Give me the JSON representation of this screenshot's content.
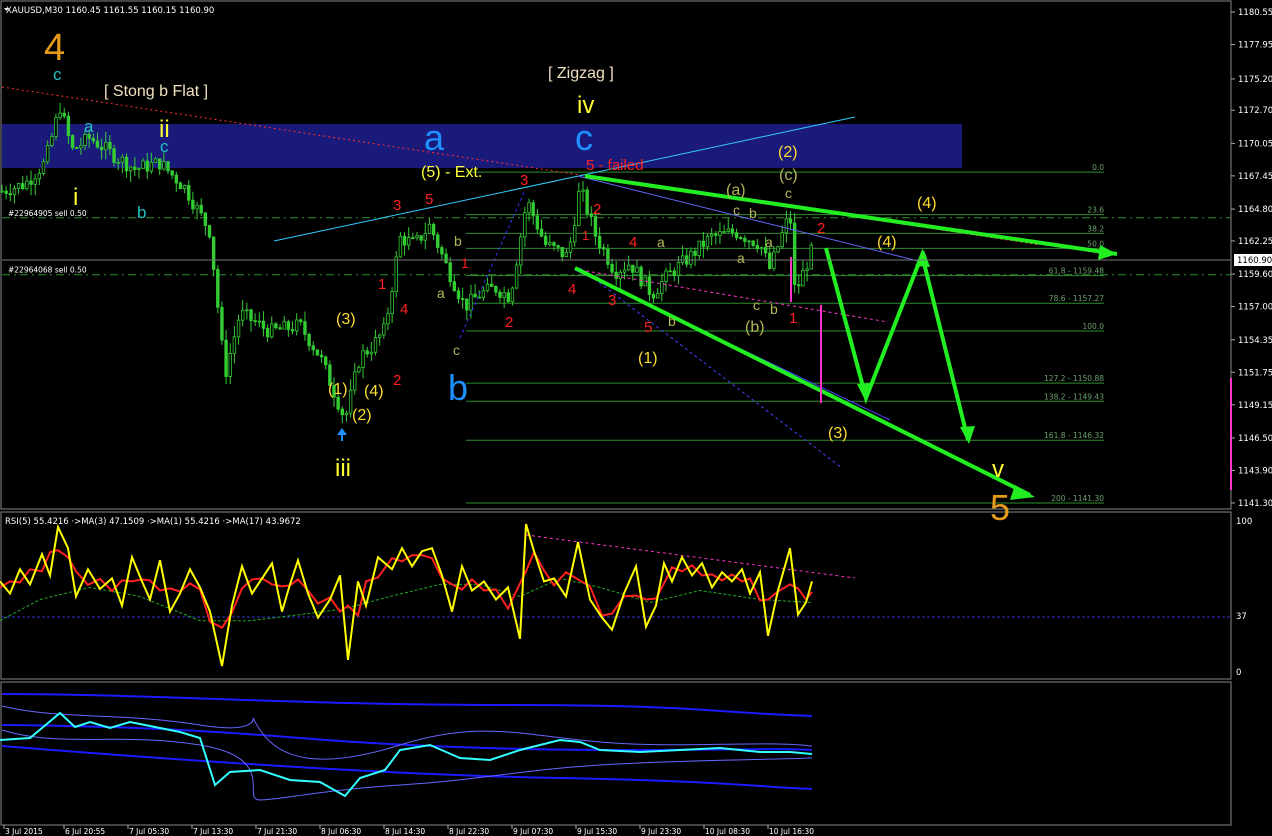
{
  "window": {
    "header": "XAUUSD,M30  1160.45 1161.55 1160.15 1160.90"
  },
  "colors": {
    "background": "#000000",
    "candles": "#33cc33",
    "price_axis_text": "#ffffff",
    "supply_zone": "#1a1a7a",
    "fib_lines": "#2e8b2e",
    "wave_red": "#ff2020",
    "wave_yellow": "#ffff33",
    "wave_blue": "#1e90ff",
    "wave_cyan": "#00ccff",
    "wave_orange": "#e69a1a",
    "wave_olive": "#b5b55a",
    "projection_arrows": "#22ee22",
    "rsi_line": "#ffff00",
    "rsi_ma3": "#ff2020",
    "rsi_ma17": "#22aa22",
    "bands": "#1a1aff",
    "osc_line": "#33ffff",
    "magenta": "#ff33cc"
  },
  "chart_data": [
    {
      "type": "candlestick",
      "title": "XAUUSD,M30",
      "ohlc": {
        "open": 1160.45,
        "high": 1161.55,
        "low": 1160.15,
        "close": 1160.9
      },
      "last_price": "1160.90",
      "ylim": [
        1140.5,
        1181.5
      ],
      "y_ticks": [
        "1180.55",
        "1177.95",
        "1175.20",
        "1172.70",
        "1170.05",
        "1167.45",
        "1164.80",
        "1162.25",
        "1159.60",
        "1157.00",
        "1154.35",
        "1151.75",
        "1149.15",
        "1146.50",
        "1143.90",
        "1141.30"
      ],
      "x_ticks": [
        "3 Jul 2015",
        "6 Jul 20:55",
        "7 Jul 05:30",
        "7 Jul 13:30",
        "7 Jul 21:30",
        "8 Jul 06:30",
        "8 Jul 14:30",
        "8 Jul 22:30",
        "9 Jul 07:30",
        "9 Jul 15:30",
        "9 Jul 23:30",
        "10 Jul 08:30",
        "10 Jul 16:30"
      ],
      "price_anchors": [
        [
          0,
          1166.2
        ],
        [
          25,
          1166.8
        ],
        [
          45,
          1168.5
        ],
        [
          60,
          1173.0
        ],
        [
          72,
          1169.5
        ],
        [
          90,
          1170.5
        ],
        [
          112,
          1169.2
        ],
        [
          135,
          1168.0
        ],
        [
          160,
          1168.5
        ],
        [
          185,
          1166.5
        ],
        [
          210,
          1163.0
        ],
        [
          225,
          1151.5
        ],
        [
          240,
          1156.5
        ],
        [
          270,
          1155.0
        ],
        [
          300,
          1155.5
        ],
        [
          320,
          1153.0
        ],
        [
          345,
          1148.0
        ],
        [
          360,
          1153.0
        ],
        [
          372,
          1153.8
        ],
        [
          385,
          1155.2
        ],
        [
          400,
          1162.5
        ],
        [
          415,
          1162.0
        ],
        [
          430,
          1163.5
        ],
        [
          445,
          1160.5
        ],
        [
          465,
          1157.0
        ],
        [
          480,
          1158.0
        ],
        [
          495,
          1158.5
        ],
        [
          510,
          1157.8
        ],
        [
          527,
          1165.5
        ],
        [
          545,
          1162.0
        ],
        [
          568,
          1161.0
        ],
        [
          580,
          1166.5
        ],
        [
          595,
          1162.8
        ],
        [
          615,
          1159.8
        ],
        [
          630,
          1160.5
        ],
        [
          652,
          1158.0
        ],
        [
          668,
          1159.5
        ],
        [
          690,
          1161.0
        ],
        [
          710,
          1162.5
        ],
        [
          735,
          1163.0
        ],
        [
          760,
          1162.0
        ],
        [
          770,
          1160.0
        ],
        [
          790,
          1164.5
        ],
        [
          795,
          1158.0
        ],
        [
          812,
          1161.5
        ]
      ],
      "candle_step": 4.15,
      "fibonacci": [
        {
          "level": "0.0",
          "price": 1167.75
        },
        {
          "level": "23.6",
          "price": 1164.35
        },
        {
          "level": "38.2",
          "price": 1162.85
        },
        {
          "level": "50.0",
          "price": 1161.65
        },
        {
          "level": "61.8 - 1159.48",
          "price": 1159.48
        },
        {
          "level": "78.6 - 1157.27",
          "price": 1157.27
        },
        {
          "level": "100.0",
          "price": 1155.05
        },
        {
          "level": "127.2 - 1150.88",
          "price": 1150.88
        },
        {
          "level": "138.2 - 1149.43",
          "price": 1149.43
        },
        {
          "level": "161.8 - 1146.32",
          "price": 1146.32
        },
        {
          "level": "200 - 1141.30",
          "price": 1141.3
        }
      ],
      "orders": [
        {
          "text": "#22964905 sell 0.50",
          "price": 1164.1
        },
        {
          "text": "#22964068 sell 0.50",
          "price": 1159.55
        }
      ],
      "annotations": {
        "bracket_1": "[ Stong b Flat ]",
        "bracket_2": "[ Zigzag ]",
        "ext": "(5) - Ext.",
        "failed": "5 - failed",
        "w4": "4",
        "w5": "5",
        "iv": "iv",
        "v": "v",
        "iii": "iii",
        "ii": "ii",
        "i": "i",
        "a": "a",
        "b": "b",
        "c": "c",
        "p1": "(1)",
        "p2": "(2)",
        "p3": "(3)",
        "p4": "(4)",
        "pa": "(a)",
        "pb": "(b)",
        "pc": "(c)",
        "n1": "1",
        "n2": "2",
        "n3": "3",
        "n4": "4",
        "n5": "5"
      }
    },
    {
      "type": "line",
      "title": "RSI(5) 55.4216  ·>MA(3) 47.1509  ·>MA(1) 55.4216  ·>MA(17) 43.9672",
      "ylim": [
        0,
        100
      ],
      "y_ticks": [
        "100",
        "37",
        "0"
      ],
      "level": 37,
      "rsi_anchors": [
        [
          0,
          60
        ],
        [
          10,
          52
        ],
        [
          20,
          68
        ],
        [
          30,
          58
        ],
        [
          42,
          78
        ],
        [
          50,
          64
        ],
        [
          58,
          96
        ],
        [
          68,
          82
        ],
        [
          76,
          50
        ],
        [
          88,
          68
        ],
        [
          100,
          55
        ],
        [
          112,
          62
        ],
        [
          122,
          44
        ],
        [
          132,
          76
        ],
        [
          142,
          60
        ],
        [
          150,
          48
        ],
        [
          160,
          74
        ],
        [
          170,
          40
        ],
        [
          180,
          52
        ],
        [
          190,
          68
        ],
        [
          200,
          56
        ],
        [
          210,
          40
        ],
        [
          222,
          4
        ],
        [
          232,
          44
        ],
        [
          242,
          70
        ],
        [
          252,
          52
        ],
        [
          262,
          62
        ],
        [
          272,
          72
        ],
        [
          282,
          40
        ],
        [
          290,
          58
        ],
        [
          298,
          74
        ],
        [
          308,
          52
        ],
        [
          318,
          36
        ],
        [
          330,
          48
        ],
        [
          340,
          64
        ],
        [
          348,
          8
        ],
        [
          358,
          60
        ],
        [
          366,
          44
        ],
        [
          378,
          76
        ],
        [
          392,
          68
        ],
        [
          402,
          82
        ],
        [
          412,
          70
        ],
        [
          422,
          80
        ],
        [
          432,
          82
        ],
        [
          442,
          64
        ],
        [
          452,
          40
        ],
        [
          462,
          70
        ],
        [
          472,
          54
        ],
        [
          484,
          60
        ],
        [
          496,
          48
        ],
        [
          508,
          56
        ],
        [
          520,
          22
        ],
        [
          526,
          98
        ],
        [
          534,
          80
        ],
        [
          544,
          60
        ],
        [
          554,
          62
        ],
        [
          566,
          50
        ],
        [
          578,
          86
        ],
        [
          590,
          48
        ],
        [
          602,
          36
        ],
        [
          612,
          28
        ],
        [
          624,
          52
        ],
        [
          636,
          70
        ],
        [
          646,
          30
        ],
        [
          656,
          44
        ],
        [
          664,
          72
        ],
        [
          672,
          60
        ],
        [
          682,
          76
        ],
        [
          692,
          64
        ],
        [
          702,
          72
        ],
        [
          712,
          56
        ],
        [
          722,
          66
        ],
        [
          732,
          60
        ],
        [
          742,
          68
        ],
        [
          750,
          52
        ],
        [
          760,
          66
        ],
        [
          768,
          24
        ],
        [
          778,
          54
        ],
        [
          790,
          82
        ],
        [
          798,
          38
        ],
        [
          806,
          46
        ],
        [
          812,
          60
        ]
      ],
      "ma17_anchors": [
        [
          0,
          34
        ],
        [
          40,
          48
        ],
        [
          90,
          56
        ],
        [
          140,
          50
        ],
        [
          200,
          34
        ],
        [
          250,
          34
        ],
        [
          300,
          38
        ],
        [
          345,
          42
        ],
        [
          390,
          50
        ],
        [
          440,
          58
        ],
        [
          480,
          58
        ],
        [
          520,
          50
        ],
        [
          560,
          62
        ],
        [
          600,
          56
        ],
        [
          650,
          46
        ],
        [
          700,
          54
        ],
        [
          760,
          48
        ],
        [
          812,
          46
        ]
      ],
      "trendline": "magenta"
    },
    {
      "type": "line",
      "title": "",
      "osc_anchors": [
        [
          0,
          740
        ],
        [
          30,
          738
        ],
        [
          60,
          713
        ],
        [
          75,
          727
        ],
        [
          90,
          722
        ],
        [
          110,
          728
        ],
        [
          130,
          722
        ],
        [
          150,
          726
        ],
        [
          180,
          732
        ],
        [
          200,
          738
        ],
        [
          215,
          785
        ],
        [
          230,
          772
        ],
        [
          260,
          770
        ],
        [
          290,
          780
        ],
        [
          320,
          782
        ],
        [
          345,
          796
        ],
        [
          360,
          778
        ],
        [
          385,
          770
        ],
        [
          400,
          750
        ],
        [
          430,
          745
        ],
        [
          460,
          758
        ],
        [
          490,
          760
        ],
        [
          520,
          750
        ],
        [
          540,
          745
        ],
        [
          560,
          740
        ],
        [
          580,
          742
        ],
        [
          600,
          750
        ],
        [
          640,
          752
        ],
        [
          680,
          750
        ],
        [
          720,
          748
        ],
        [
          760,
          752
        ],
        [
          790,
          752
        ],
        [
          812,
          754
        ]
      ]
    }
  ]
}
